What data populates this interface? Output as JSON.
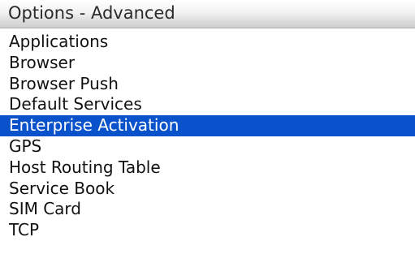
{
  "screen": {
    "title": "Options - Advanced"
  },
  "menu": {
    "selected_index": 4,
    "items": [
      {
        "label": "Applications"
      },
      {
        "label": "Browser"
      },
      {
        "label": "Browser Push"
      },
      {
        "label": "Default Services"
      },
      {
        "label": "Enterprise Activation"
      },
      {
        "label": "GPS"
      },
      {
        "label": "Host Routing Table"
      },
      {
        "label": "Service Book"
      },
      {
        "label": "SIM Card"
      },
      {
        "label": "TCP"
      }
    ]
  },
  "colors": {
    "selection": "#0a52cc",
    "background": "#ffffff",
    "text": "#111111"
  }
}
